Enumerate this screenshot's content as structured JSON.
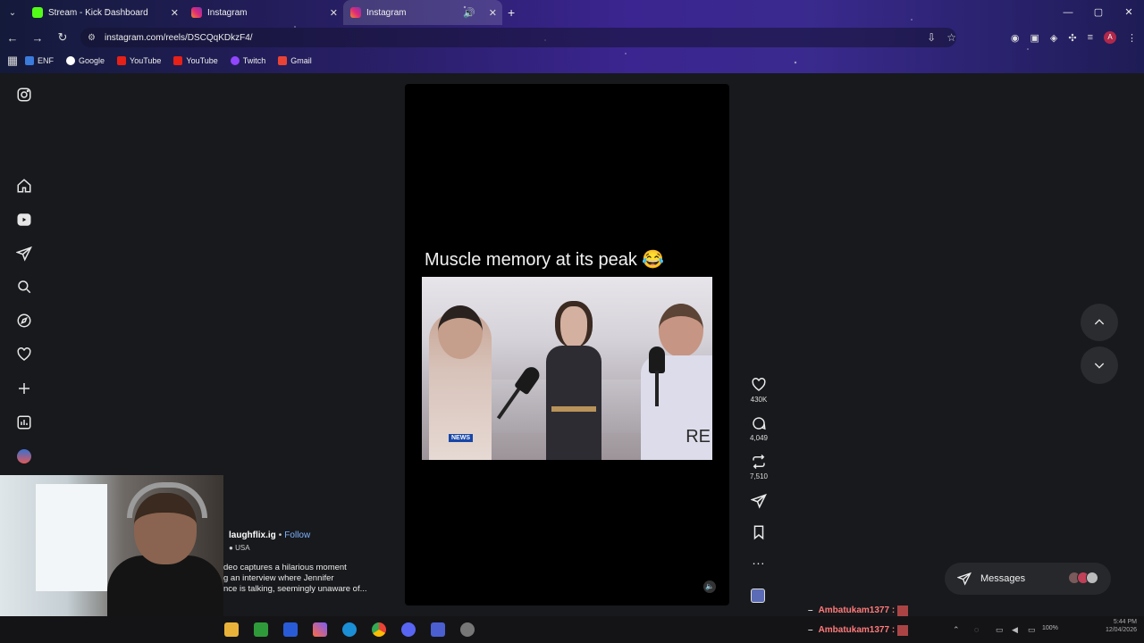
{
  "browser": {
    "tabs": [
      {
        "label": "Stream - Kick Dashboard",
        "favicon": "kick-icon"
      },
      {
        "label": "Instagram",
        "favicon": "instagram-icon"
      },
      {
        "label": "Instagram",
        "favicon": "instagram-icon",
        "active": true
      }
    ],
    "url": "instagram.com/reels/DSCQqKDkzF4/",
    "bookmarks": [
      "ENF",
      "Google",
      "YouTube",
      "YouTube",
      "Twitch",
      "Gmail"
    ]
  },
  "reel": {
    "caption_overlay": "Muscle memory at its peak 😂",
    "video_tags": {
      "news": "NEWS",
      "corner": "RE"
    },
    "author": "laughflix.ig",
    "separator": "•",
    "follow_label": "Follow",
    "location": "USA",
    "description_lines": [
      "deo captures a hilarious moment",
      "g an interview where Jennifer",
      "nce is talking, seemingly unaware of..."
    ],
    "likes": "430K",
    "comments": "4,049",
    "reposts": "7,510",
    "more_label": "..."
  },
  "messages": {
    "label": "Messages"
  },
  "chat_overlay": [
    {
      "user": "Ambatukam1377 :"
    },
    {
      "user": "Ambatukam1377 :"
    }
  ],
  "tray": {
    "battery": "100%",
    "time": "5:44 PM",
    "date": "12/04/2026"
  },
  "colors": {
    "accent_follow": "#7fb2ff",
    "chat_name": "#ff7a7a",
    "kick_green": "#53fc18"
  }
}
